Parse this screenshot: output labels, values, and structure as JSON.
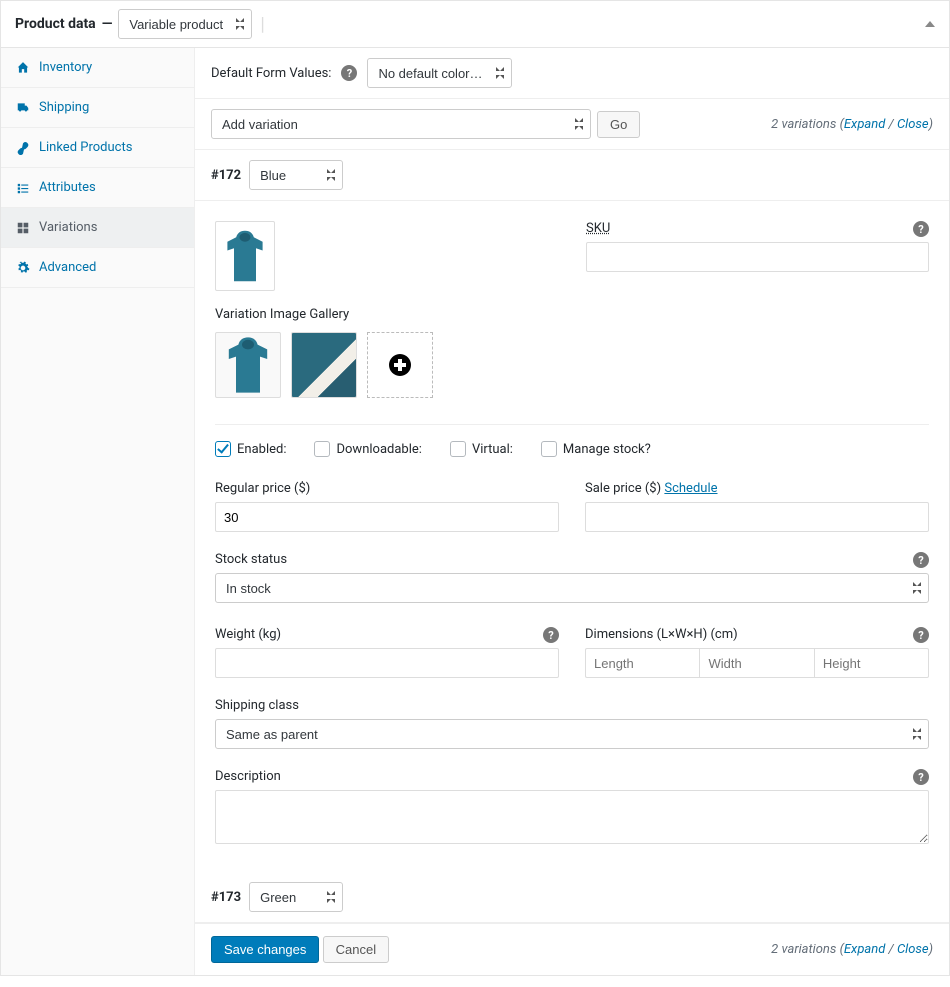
{
  "header": {
    "title": "Product data",
    "product_type": "Variable product"
  },
  "tabs": {
    "inventory": "Inventory",
    "shipping": "Shipping",
    "linked": "Linked Products",
    "attributes": "Attributes",
    "variations": "Variations",
    "advanced": "Advanced"
  },
  "defaults": {
    "label": "Default Form Values:",
    "value": "No default color…"
  },
  "toolbox": {
    "action": "Add variation",
    "go": "Go",
    "count_text": "2 variations",
    "expand": "Expand",
    "close": "Close"
  },
  "variation1": {
    "id": "#172",
    "attr": "Blue",
    "gallery_label": "Variation Image Gallery",
    "sku_label": "SKU",
    "checks": {
      "enabled": "Enabled:",
      "downloadable": "Downloadable:",
      "virtual": "Virtual:",
      "manage_stock": "Manage stock?"
    },
    "regular_price_label": "Regular price ($)",
    "regular_price": "30",
    "sale_price_label": "Sale price ($)",
    "schedule": "Schedule",
    "stock_status_label": "Stock status",
    "stock_status": "In stock",
    "weight_label": "Weight (kg)",
    "dimensions_label": "Dimensions (L×W×H) (cm)",
    "dim_l_ph": "Length",
    "dim_w_ph": "Width",
    "dim_h_ph": "Height",
    "shipping_class_label": "Shipping class",
    "shipping_class": "Same as parent",
    "description_label": "Description"
  },
  "variation2": {
    "id": "#173",
    "attr": "Green"
  },
  "footer": {
    "save": "Save changes",
    "cancel": "Cancel"
  }
}
